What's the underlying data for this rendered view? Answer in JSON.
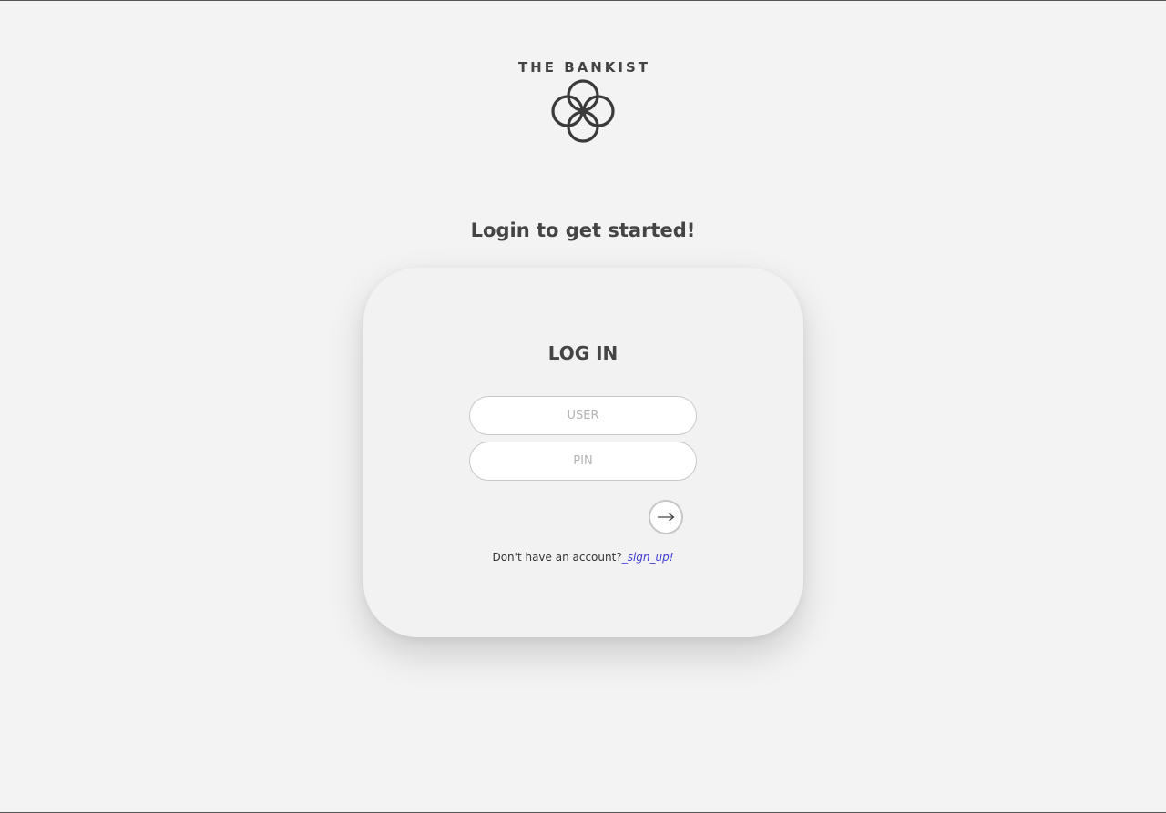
{
  "brand": {
    "name": "THE  BANKIST",
    "logo_icon": "four-interlocking-rings-logo",
    "logo_color": "#3a3a3a"
  },
  "tagline": "Login to get started!",
  "login_card": {
    "title": "LOG IN",
    "user_field": {
      "value": "",
      "placeholder": "USER"
    },
    "pin_field": {
      "value": "",
      "placeholder": "PIN"
    },
    "submit_icon": "right-arrow-icon",
    "submit_label": "→",
    "signup_prompt": "Don't have an account?",
    "signup_link": "_sign_up!"
  },
  "colors": {
    "background": "#f3f3f3",
    "text": "#444444",
    "link": "#3b3bd6",
    "field_border": "#c8c8c8"
  }
}
